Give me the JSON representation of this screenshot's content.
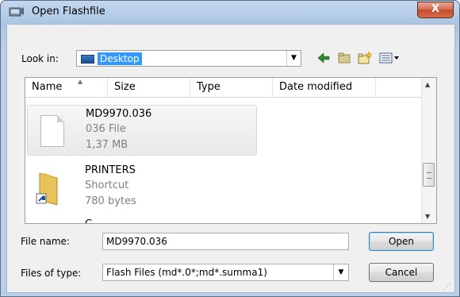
{
  "window": {
    "title": "Open Flashfile",
    "close_label": "X"
  },
  "toolbar": {
    "lookin_label": "Look in:",
    "lookin_value": "Desktop",
    "icons": [
      "back-arrow-icon",
      "up-folder-icon",
      "new-folder-icon",
      "view-menu-icon"
    ]
  },
  "list": {
    "columns": [
      "Name",
      "Size",
      "Type",
      "Date modified"
    ],
    "items": [
      {
        "name": "MD9970.036",
        "type": "036 File",
        "size": "1,37 MB",
        "icon": "document-icon",
        "selected": true
      },
      {
        "name": "PRINTERS",
        "type": "Shortcut",
        "size": "780 bytes",
        "icon": "folder-shortcut-icon",
        "selected": false
      },
      {
        "name": "C",
        "type": "",
        "size": "",
        "icon": "folder-icon",
        "selected": false
      }
    ]
  },
  "filename": {
    "label": "File name:",
    "value": "MD9970.036"
  },
  "filetype": {
    "label": "Files of type:",
    "value": "Flash Files (md*.0*;md*.summa1)"
  },
  "buttons": {
    "open": "Open",
    "cancel": "Cancel"
  },
  "colors": {
    "selection": "#3399ff",
    "close": "#c44b2e",
    "title_bar": "#b9d0e8"
  }
}
